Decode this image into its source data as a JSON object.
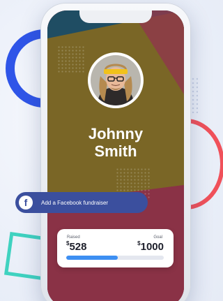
{
  "profile": {
    "first_name": "Johnny",
    "last_name": "Smith",
    "avatar_description": "portrait-avatar"
  },
  "facebook_button": {
    "label": "Add a Facebook fundraiser",
    "icon": "facebook-icon"
  },
  "fundraiser": {
    "raised_label": "Raised",
    "raised_currency": "$",
    "raised_amount": "528",
    "goal_label": "Goal",
    "goal_currency": "$",
    "goal_amount": "1000",
    "progress_fraction": 0.528
  },
  "colors": {
    "screen_top": "#1f4d63",
    "screen_mid": "#7a6626",
    "screen_bottom": "#8a3246",
    "facebook_blue": "#3b4f9e",
    "progress_fill": "#3d8ff2",
    "ring_blue": "#2f55e8",
    "ring_red": "#f0515a",
    "square_teal": "#3fd2c0"
  }
}
